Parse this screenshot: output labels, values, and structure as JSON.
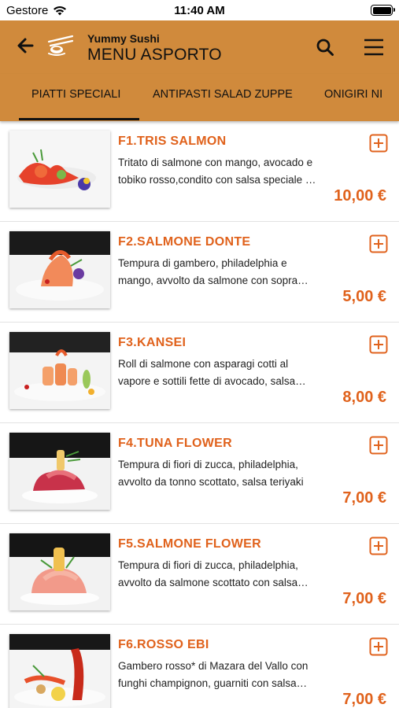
{
  "status_bar": {
    "carrier": "Gestore",
    "time": "11:40 AM"
  },
  "header": {
    "app_name": "Yummy Sushi",
    "title": "MENU ASPORTO"
  },
  "tabs": [
    {
      "label": "PIATTI SPECIALI",
      "active": true
    },
    {
      "label": "ANTIPASTI SALAD ZUPPE",
      "active": false
    },
    {
      "label": "ONIGIRI NI",
      "active": false
    }
  ],
  "items": [
    {
      "name": "F1.TRIS SALMON",
      "description": "Tritato di salmone con mango, avocado e tobiko rosso,condito con salsa speciale e verdure",
      "price": "10,00 €"
    },
    {
      "name": "F2.SALMONE DONTE",
      "description": "Tempura di gambero, philadelphia e mango, avvolto da salmone con sopra salsa teriyaki",
      "price": "5,00 €"
    },
    {
      "name": "F3.KANSEI",
      "description": "Roll di salmone con asparagi cotti al vapore e sottili fette di avocado, salsa speciale",
      "price": "8,00 €"
    },
    {
      "name": "F4.TUNA FLOWER",
      "description": "Tempura di fiori di zucca, philadelphia, avvolto da tonno scottato, salsa teriyaki",
      "price": "7,00 €"
    },
    {
      "name": "F5.SALMONE FLOWER",
      "description": "Tempura di fiori di zucca, philadelphia, avvolto da salmone scottato con salsa teriyaki",
      "price": "7,00 €"
    },
    {
      "name": "F6.ROSSO EBI",
      "description": "Gambero rosso* di Mazara del Vallo con funghi champignon, guarniti con salsa speciale",
      "price": "7,00 €"
    }
  ],
  "colors": {
    "header_bg": "#d08a3c",
    "accent": "#e0621c"
  },
  "icons": {
    "back": "arrow-left-icon",
    "logo": "chopsticks-sushi-logo",
    "search": "search-icon",
    "menu": "hamburger-menu-icon",
    "add": "plus-square-icon"
  }
}
